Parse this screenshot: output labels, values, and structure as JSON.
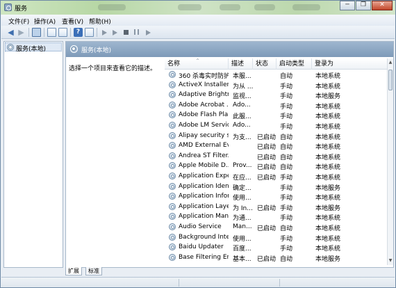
{
  "window": {
    "title": "服务",
    "minimize_glyph": "─",
    "restore_glyph": "❐",
    "close_glyph": "✕"
  },
  "menu": [
    "文件(F)",
    "操作(A)",
    "查看(V)",
    "帮助(H)"
  ],
  "toolbar": {
    "back_icon": "◀",
    "forward_icon": "▶",
    "help_label": "?"
  },
  "tree": {
    "root_label": "服务(本地)"
  },
  "pane": {
    "header": "服务(本地)",
    "description": "选择一个项目来查看它的描述。"
  },
  "columns": [
    "名称",
    "描述",
    "状态",
    "启动类型",
    "登录为"
  ],
  "services": [
    {
      "name": "360 杀毒实时防护...",
      "desc": "本服...",
      "status": "",
      "startup": "自动",
      "logon": "本地系统"
    },
    {
      "name": "ActiveX Installer ...",
      "desc": "为从 ...",
      "status": "",
      "startup": "手动",
      "logon": "本地系统"
    },
    {
      "name": "Adaptive Brightn...",
      "desc": "监视...",
      "status": "",
      "startup": "手动",
      "logon": "本地服务"
    },
    {
      "name": "Adobe Acrobat ...",
      "desc": "Ado...",
      "status": "",
      "startup": "手动",
      "logon": "本地系统"
    },
    {
      "name": "Adobe Flash Pla...",
      "desc": "此服...",
      "status": "",
      "startup": "手动",
      "logon": "本地系统"
    },
    {
      "name": "Adobe LM Service",
      "desc": "Ado...",
      "status": "",
      "startup": "手动",
      "logon": "本地系统"
    },
    {
      "name": "Alipay security s...",
      "desc": "为支...",
      "status": "已启动",
      "startup": "自动",
      "logon": "本地系统"
    },
    {
      "name": "AMD External Ev...",
      "desc": "",
      "status": "已启动",
      "startup": "自动",
      "logon": "本地系统"
    },
    {
      "name": "Andrea ST Filter...",
      "desc": "",
      "status": "已启动",
      "startup": "自动",
      "logon": "本地系统"
    },
    {
      "name": "Apple Mobile D...",
      "desc": "Prov...",
      "status": "已启动",
      "startup": "自动",
      "logon": "本地系统"
    },
    {
      "name": "Application Expe...",
      "desc": "在应...",
      "status": "已启动",
      "startup": "手动",
      "logon": "本地系统"
    },
    {
      "name": "Application Iden...",
      "desc": "确定...",
      "status": "",
      "startup": "手动",
      "logon": "本地服务"
    },
    {
      "name": "Application Infor...",
      "desc": "使用...",
      "status": "",
      "startup": "手动",
      "logon": "本地系统"
    },
    {
      "name": "Application Laye...",
      "desc": "为 In...",
      "status": "已启动",
      "startup": "手动",
      "logon": "本地服务"
    },
    {
      "name": "Application Man...",
      "desc": "为通...",
      "status": "",
      "startup": "手动",
      "logon": "本地系统"
    },
    {
      "name": "Audio Service",
      "desc": "Man...",
      "status": "已启动",
      "startup": "自动",
      "logon": "本地系统"
    },
    {
      "name": "Background Inte...",
      "desc": "使用...",
      "status": "",
      "startup": "手动",
      "logon": "本地系统"
    },
    {
      "name": "Baidu Updater",
      "desc": "百度...",
      "status": "",
      "startup": "手动",
      "logon": "本地系统"
    },
    {
      "name": "Base Filtering En...",
      "desc": "基本...",
      "status": "已启动",
      "startup": "自动",
      "logon": "本地服务"
    }
  ],
  "tabs": [
    "扩展",
    "标准"
  ],
  "scrollbar": {
    "up": "▲",
    "down": "▼"
  }
}
